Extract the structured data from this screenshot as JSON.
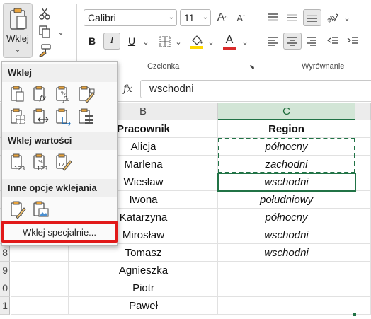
{
  "ribbon": {
    "paste_label": "Wklej",
    "font_name": "Calibri",
    "font_size": "11",
    "bold": "B",
    "italic": "I",
    "underline": "U",
    "font_color_letter": "A",
    "group_font": "Czcionka",
    "group_alignment": "Wyrównanie"
  },
  "formula_bar": {
    "fx": "fx",
    "value": "wschodni"
  },
  "paste_menu": {
    "section_paste": "Wklej",
    "section_values": "Wklej wartości",
    "section_other": "Inne opcje wklejania",
    "paste_special": "Wklej specjalnie..."
  },
  "grid": {
    "columns": [
      "B",
      "C"
    ],
    "row_numbers": [
      "9",
      "0",
      "1"
    ],
    "row_number_8": "8",
    "header_b": "Pracownik",
    "header_c": "Region",
    "rows": [
      {
        "b": "Alicja",
        "c": "północny"
      },
      {
        "b": "Marlena",
        "c": "zachodni"
      },
      {
        "b": "Wiesław",
        "c": "wschodni"
      },
      {
        "b": "Iwona",
        "c": "południowy"
      },
      {
        "b": "Katarzyna",
        "c": "północny"
      },
      {
        "b": "Mirosław",
        "c": "wschodni"
      },
      {
        "b": "Tomasz",
        "c": "wschodni"
      },
      {
        "b": "Agnieszka",
        "c": ""
      },
      {
        "b": "Piotr",
        "c": ""
      },
      {
        "b": "Paweł",
        "c": ""
      }
    ]
  },
  "colors": {
    "accent_green": "#217346",
    "highlight_red": "#e11919",
    "fill_yellow": "#ffd800",
    "font_red": "#d92b2b"
  }
}
